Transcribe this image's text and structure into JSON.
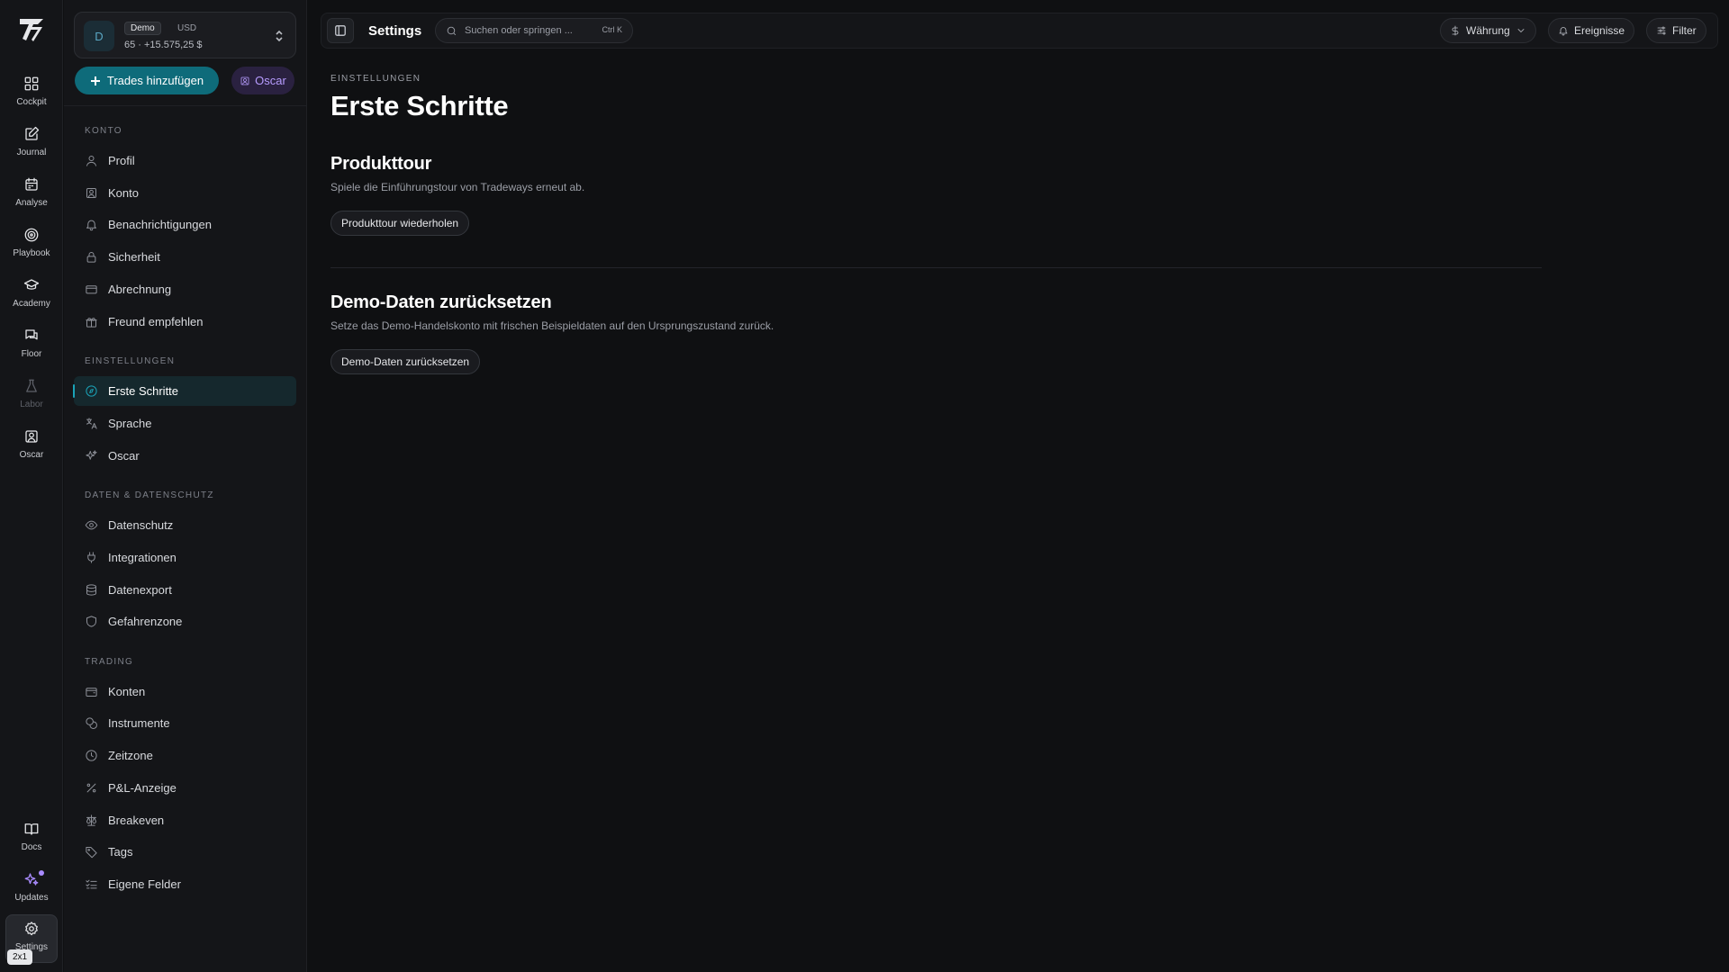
{
  "rail": {
    "items": [
      {
        "label": "Cockpit",
        "icon": "grid-icon"
      },
      {
        "label": "Journal",
        "icon": "edit-icon"
      },
      {
        "label": "Analyse",
        "icon": "calendar-icon"
      },
      {
        "label": "Playbook",
        "icon": "target-icon"
      },
      {
        "label": "Academy",
        "icon": "graduation-cap-icon"
      },
      {
        "label": "Floor",
        "icon": "chat-icon"
      },
      {
        "label": "Labor",
        "icon": "flask-icon"
      },
      {
        "label": "Oscar",
        "icon": "user-square-icon"
      }
    ],
    "bottom": [
      {
        "label": "Docs",
        "icon": "book-icon"
      },
      {
        "label": "Updates",
        "icon": "sparkles-icon"
      },
      {
        "label": "Settings",
        "icon": "gear-icon"
      }
    ],
    "kbd_hint": "2x1"
  },
  "account": {
    "avatar": "D",
    "badge": "Demo",
    "currency": "USD",
    "balance": "65 · +15.575,25 $"
  },
  "actions": {
    "add_trades": "Trades hinzufügen",
    "oscar": "Oscar"
  },
  "sidebar": {
    "sections": [
      {
        "title": "KONTO",
        "items": [
          {
            "label": "Profil",
            "icon": "user-icon"
          },
          {
            "label": "Konto",
            "icon": "id-card-icon"
          },
          {
            "label": "Benachrichtigungen",
            "icon": "bell-icon"
          },
          {
            "label": "Sicherheit",
            "icon": "lock-icon"
          },
          {
            "label": "Abrechnung",
            "icon": "credit-card-icon"
          },
          {
            "label": "Freund empfehlen",
            "icon": "gift-icon"
          }
        ]
      },
      {
        "title": "EINSTELLUNGEN",
        "items": [
          {
            "label": "Erste Schritte",
            "icon": "compass-icon",
            "active": true
          },
          {
            "label": "Sprache",
            "icon": "translate-icon"
          },
          {
            "label": "Oscar",
            "icon": "sparkles-icon"
          }
        ]
      },
      {
        "title": "DATEN & DATENSCHUTZ",
        "items": [
          {
            "label": "Datenschutz",
            "icon": "eye-icon"
          },
          {
            "label": "Integrationen",
            "icon": "plug-icon"
          },
          {
            "label": "Datenexport",
            "icon": "database-icon"
          },
          {
            "label": "Gefahrenzone",
            "icon": "shield-icon"
          }
        ]
      },
      {
        "title": "TRADING",
        "items": [
          {
            "label": "Konten",
            "icon": "wallet-icon"
          },
          {
            "label": "Instrumente",
            "icon": "coins-icon"
          },
          {
            "label": "Zeitzone",
            "icon": "clock-icon"
          },
          {
            "label": "P&L-Anzeige",
            "icon": "percent-icon"
          },
          {
            "label": "Breakeven",
            "icon": "scale-icon"
          },
          {
            "label": "Tags",
            "icon": "tag-icon"
          },
          {
            "label": "Eigene Felder",
            "icon": "list-check-icon"
          }
        ]
      }
    ]
  },
  "topbar": {
    "title": "Settings",
    "search_placeholder": "Suchen oder springen ...",
    "search_shortcut": "Ctrl K",
    "currency": "Währung",
    "events": "Ereignisse",
    "filter": "Filter"
  },
  "page": {
    "eyebrow": "EINSTELLUNGEN",
    "title": "Erste Schritte",
    "tour": {
      "title": "Produkttour",
      "description": "Spiele die Einführungstour von Tradeways erneut ab.",
      "button": "Produkttour wiederholen"
    },
    "reset": {
      "title": "Demo-Daten zurücksetzen",
      "description": "Setze das Demo-Handelskonto mit frischen Beispieldaten auf den Ursprungszustand zurück.",
      "button": "Demo-Daten zurücksetzen"
    }
  },
  "colors": {
    "accent": "#0e6b7a",
    "accent_active": "#1aa3b8",
    "oscar_purple": "#b79cff",
    "background": "#0f1012"
  }
}
